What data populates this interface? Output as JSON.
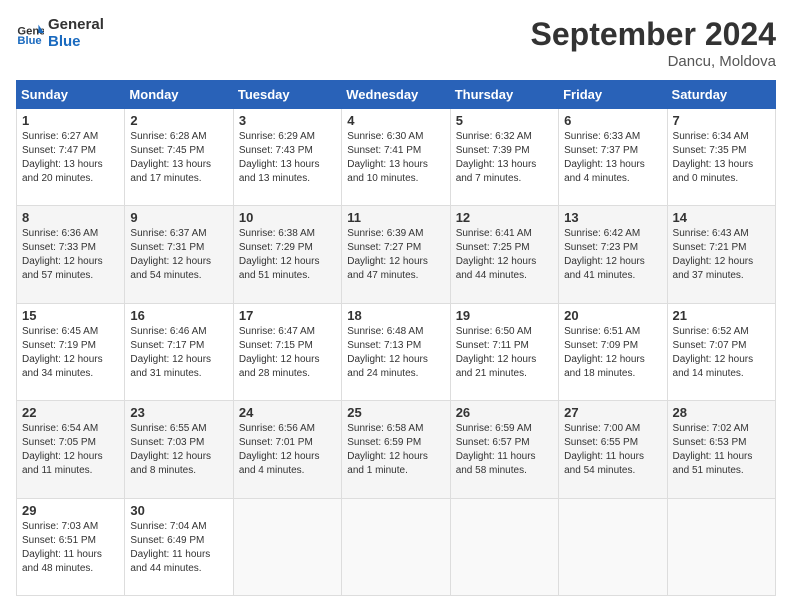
{
  "logo": {
    "line1": "General",
    "line2": "Blue"
  },
  "title": "September 2024",
  "location": "Dancu, Moldova",
  "days_header": [
    "Sunday",
    "Monday",
    "Tuesday",
    "Wednesday",
    "Thursday",
    "Friday",
    "Saturday"
  ],
  "weeks": [
    [
      {
        "day": "1",
        "text": "Sunrise: 6:27 AM\nSunset: 7:47 PM\nDaylight: 13 hours\nand 20 minutes."
      },
      {
        "day": "2",
        "text": "Sunrise: 6:28 AM\nSunset: 7:45 PM\nDaylight: 13 hours\nand 17 minutes."
      },
      {
        "day": "3",
        "text": "Sunrise: 6:29 AM\nSunset: 7:43 PM\nDaylight: 13 hours\nand 13 minutes."
      },
      {
        "day": "4",
        "text": "Sunrise: 6:30 AM\nSunset: 7:41 PM\nDaylight: 13 hours\nand 10 minutes."
      },
      {
        "day": "5",
        "text": "Sunrise: 6:32 AM\nSunset: 7:39 PM\nDaylight: 13 hours\nand 7 minutes."
      },
      {
        "day": "6",
        "text": "Sunrise: 6:33 AM\nSunset: 7:37 PM\nDaylight: 13 hours\nand 4 minutes."
      },
      {
        "day": "7",
        "text": "Sunrise: 6:34 AM\nSunset: 7:35 PM\nDaylight: 13 hours\nand 0 minutes."
      }
    ],
    [
      {
        "day": "8",
        "text": "Sunrise: 6:36 AM\nSunset: 7:33 PM\nDaylight: 12 hours\nand 57 minutes."
      },
      {
        "day": "9",
        "text": "Sunrise: 6:37 AM\nSunset: 7:31 PM\nDaylight: 12 hours\nand 54 minutes."
      },
      {
        "day": "10",
        "text": "Sunrise: 6:38 AM\nSunset: 7:29 PM\nDaylight: 12 hours\nand 51 minutes."
      },
      {
        "day": "11",
        "text": "Sunrise: 6:39 AM\nSunset: 7:27 PM\nDaylight: 12 hours\nand 47 minutes."
      },
      {
        "day": "12",
        "text": "Sunrise: 6:41 AM\nSunset: 7:25 PM\nDaylight: 12 hours\nand 44 minutes."
      },
      {
        "day": "13",
        "text": "Sunrise: 6:42 AM\nSunset: 7:23 PM\nDaylight: 12 hours\nand 41 minutes."
      },
      {
        "day": "14",
        "text": "Sunrise: 6:43 AM\nSunset: 7:21 PM\nDaylight: 12 hours\nand 37 minutes."
      }
    ],
    [
      {
        "day": "15",
        "text": "Sunrise: 6:45 AM\nSunset: 7:19 PM\nDaylight: 12 hours\nand 34 minutes."
      },
      {
        "day": "16",
        "text": "Sunrise: 6:46 AM\nSunset: 7:17 PM\nDaylight: 12 hours\nand 31 minutes."
      },
      {
        "day": "17",
        "text": "Sunrise: 6:47 AM\nSunset: 7:15 PM\nDaylight: 12 hours\nand 28 minutes."
      },
      {
        "day": "18",
        "text": "Sunrise: 6:48 AM\nSunset: 7:13 PM\nDaylight: 12 hours\nand 24 minutes."
      },
      {
        "day": "19",
        "text": "Sunrise: 6:50 AM\nSunset: 7:11 PM\nDaylight: 12 hours\nand 21 minutes."
      },
      {
        "day": "20",
        "text": "Sunrise: 6:51 AM\nSunset: 7:09 PM\nDaylight: 12 hours\nand 18 minutes."
      },
      {
        "day": "21",
        "text": "Sunrise: 6:52 AM\nSunset: 7:07 PM\nDaylight: 12 hours\nand 14 minutes."
      }
    ],
    [
      {
        "day": "22",
        "text": "Sunrise: 6:54 AM\nSunset: 7:05 PM\nDaylight: 12 hours\nand 11 minutes."
      },
      {
        "day": "23",
        "text": "Sunrise: 6:55 AM\nSunset: 7:03 PM\nDaylight: 12 hours\nand 8 minutes."
      },
      {
        "day": "24",
        "text": "Sunrise: 6:56 AM\nSunset: 7:01 PM\nDaylight: 12 hours\nand 4 minutes."
      },
      {
        "day": "25",
        "text": "Sunrise: 6:58 AM\nSunset: 6:59 PM\nDaylight: 12 hours\nand 1 minute."
      },
      {
        "day": "26",
        "text": "Sunrise: 6:59 AM\nSunset: 6:57 PM\nDaylight: 11 hours\nand 58 minutes."
      },
      {
        "day": "27",
        "text": "Sunrise: 7:00 AM\nSunset: 6:55 PM\nDaylight: 11 hours\nand 54 minutes."
      },
      {
        "day": "28",
        "text": "Sunrise: 7:02 AM\nSunset: 6:53 PM\nDaylight: 11 hours\nand 51 minutes."
      }
    ],
    [
      {
        "day": "29",
        "text": "Sunrise: 7:03 AM\nSunset: 6:51 PM\nDaylight: 11 hours\nand 48 minutes."
      },
      {
        "day": "30",
        "text": "Sunrise: 7:04 AM\nSunset: 6:49 PM\nDaylight: 11 hours\nand 44 minutes."
      },
      {
        "day": "",
        "text": ""
      },
      {
        "day": "",
        "text": ""
      },
      {
        "day": "",
        "text": ""
      },
      {
        "day": "",
        "text": ""
      },
      {
        "day": "",
        "text": ""
      }
    ]
  ]
}
